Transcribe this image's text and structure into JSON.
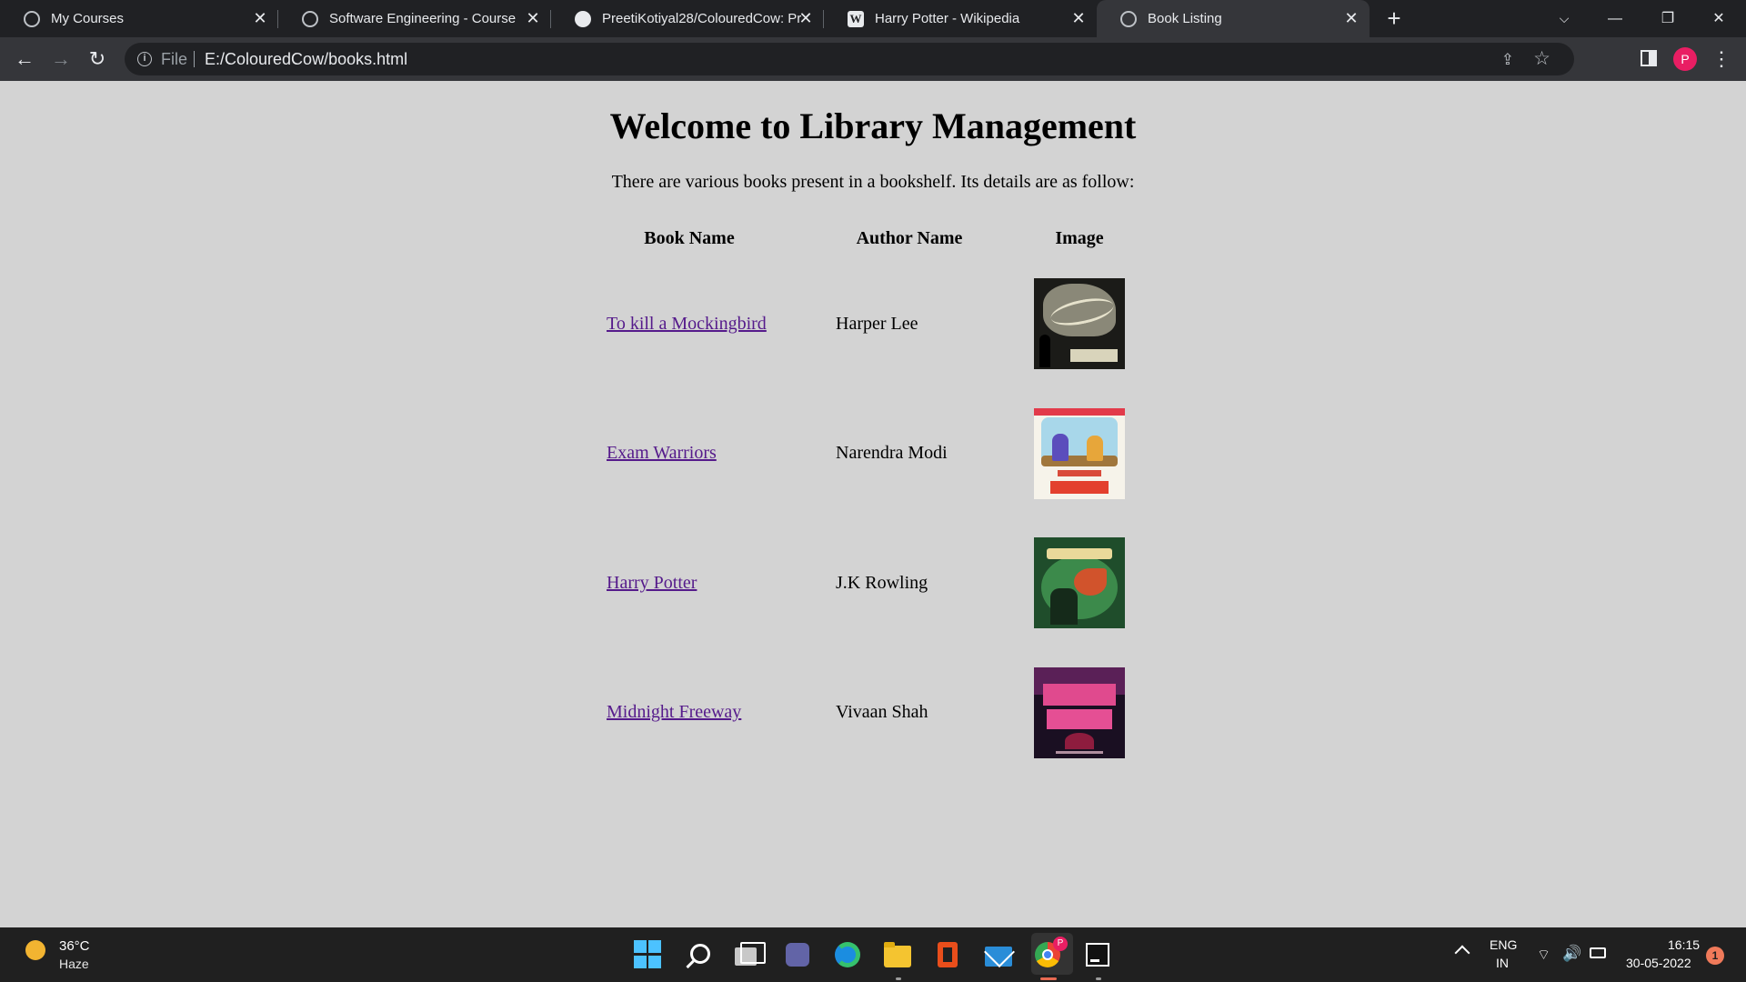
{
  "browser": {
    "tabs": [
      {
        "title": "My Courses",
        "icon": "globe-icon"
      },
      {
        "title": "Software Engineering - Course",
        "icon": "globe-icon"
      },
      {
        "title": "PreetiKotiyal28/ColouredCow: Pr",
        "icon": "github-icon"
      },
      {
        "title": "Harry Potter - Wikipedia",
        "icon": "wikipedia-icon"
      },
      {
        "title": "Book Listing",
        "icon": "globe-icon",
        "active": true
      }
    ],
    "address": {
      "scheme_label": "File",
      "url": "E:/ColouredCow/books.html"
    },
    "profile_initial": "P"
  },
  "page": {
    "heading": "Welcome to Library Management",
    "intro": "There are various books present in a bookshelf. Its details are as follow:",
    "table": {
      "headers": [
        "Book Name",
        "Author Name",
        "Image"
      ],
      "rows": [
        {
          "book": "To kill a Mockingbird",
          "author": "Harper Lee"
        },
        {
          "book": "Exam Warriors",
          "author": "Narendra Modi"
        },
        {
          "book": "Harry Potter",
          "author": "J.K Rowling"
        },
        {
          "book": "Midnight Freeway",
          "author": "Vivaan Shah"
        }
      ]
    },
    "colors": {
      "link": "#551a8b",
      "background": "#d3d3d3"
    }
  },
  "taskbar": {
    "weather": {
      "temp": "36°C",
      "condition": "Haze"
    },
    "language": {
      "line1": "ENG",
      "line2": "IN"
    },
    "clock": {
      "time": "16:15",
      "date": "30-05-2022"
    },
    "notification_count": "1",
    "chrome_badge": "P"
  }
}
